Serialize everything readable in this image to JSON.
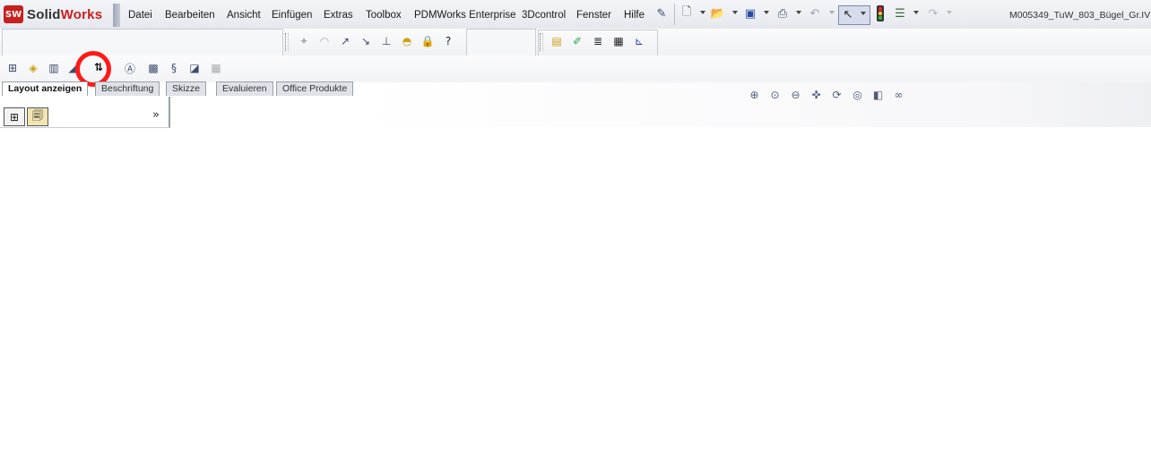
{
  "app": {
    "brand_prefix": "Solid",
    "brand_suffix": "Works",
    "logo_letters": "SW"
  },
  "menu": [
    {
      "label": "Datei"
    },
    {
      "label": "Bearbeiten"
    },
    {
      "label": "Ansicht"
    },
    {
      "label": "Einfügen"
    },
    {
      "label": "Extras"
    },
    {
      "label": "Toolbox"
    },
    {
      "label": "PDMWorks Enterprise"
    },
    {
      "label": "3Dcontrol"
    },
    {
      "label": "Fenster"
    },
    {
      "label": "Hilfe"
    }
  ],
  "document_title": "M005349_TuW_803_Bügel_Gr.IV",
  "toolbar_icons": {
    "main": [
      "pin-icon",
      "new-document-icon",
      "open-folder-icon",
      "save-icon",
      "print-icon",
      "undo-icon",
      "select-pointer-icon",
      "traffic-light-icon",
      "options-icon",
      "redo-icon"
    ],
    "sketch": [
      "point-icon",
      "arc-icon",
      "line-arrow-icon",
      "diagonal-arrow-icon",
      "baseline-icon",
      "dome-icon",
      "lock-icon",
      "help-question-icon"
    ],
    "layers": [
      "layer-stack-icon",
      "brush-icon",
      "line-weight-icon",
      "line-style-icon",
      "axis-icon"
    ],
    "drawing": [
      "model-view-icon",
      "note-icon",
      "bom-icon",
      "dimension-icon",
      "rotate-dimension-icon",
      "annotation-text-icon",
      "hole-callout-icon",
      "spring-icon",
      "balloon-icon",
      "table-icon"
    ],
    "view": [
      "zoom-fit-icon",
      "zoom-area-icon",
      "zoom-out-icon",
      "pan-icon",
      "rotate-view-icon",
      "view-orient-icon",
      "display-style-icon",
      "glasses-icon"
    ]
  },
  "tabs": [
    {
      "label": "Layout anzeigen",
      "active": true
    },
    {
      "label": "Beschriftung",
      "active": false
    },
    {
      "label": "Skizze",
      "active": false
    },
    {
      "label": "Evaluieren",
      "active": false
    },
    {
      "label": "Office Produkte",
      "active": false
    }
  ],
  "feature_manager": {
    "expand_label": "»"
  },
  "colors": {
    "brand_red": "#c8201e",
    "highlight_circle": "#ff1a1a"
  }
}
